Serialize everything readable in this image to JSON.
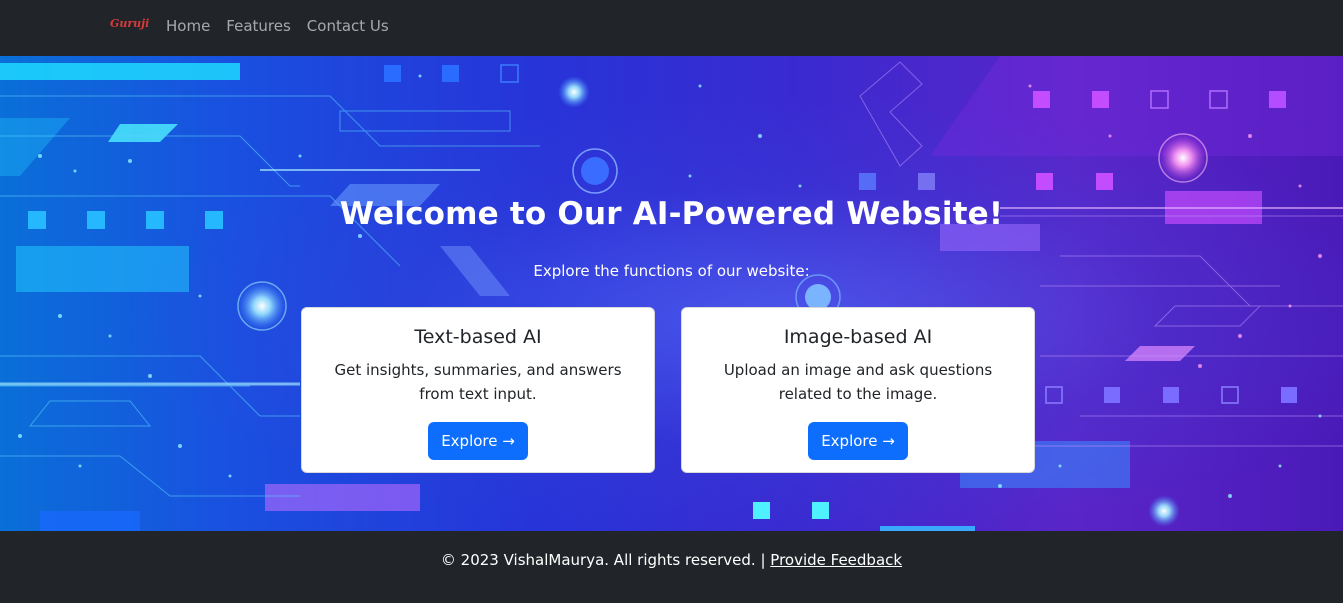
{
  "navbar": {
    "brand": "Guruji",
    "links": [
      "Home",
      "Features",
      "Contact Us"
    ]
  },
  "hero": {
    "title": "Welcome to Our AI-Powered Website!",
    "subtitle": "Explore the functions of our website:"
  },
  "cards": [
    {
      "title": "Text-based AI",
      "text": "Get insights, summaries, and answers from text input.",
      "button": "Explore →"
    },
    {
      "title": "Image-based AI",
      "text": "Upload an image and ask questions related to the image.",
      "button": "Explore →"
    }
  ],
  "footer": {
    "copyright": "© 2023 VishalMaurya. All rights reserved. |",
    "link": "Provide Feedback"
  },
  "colors": {
    "navbar": "#212529",
    "primary_button": "#0d6efd",
    "brand": "#d93a3a"
  }
}
